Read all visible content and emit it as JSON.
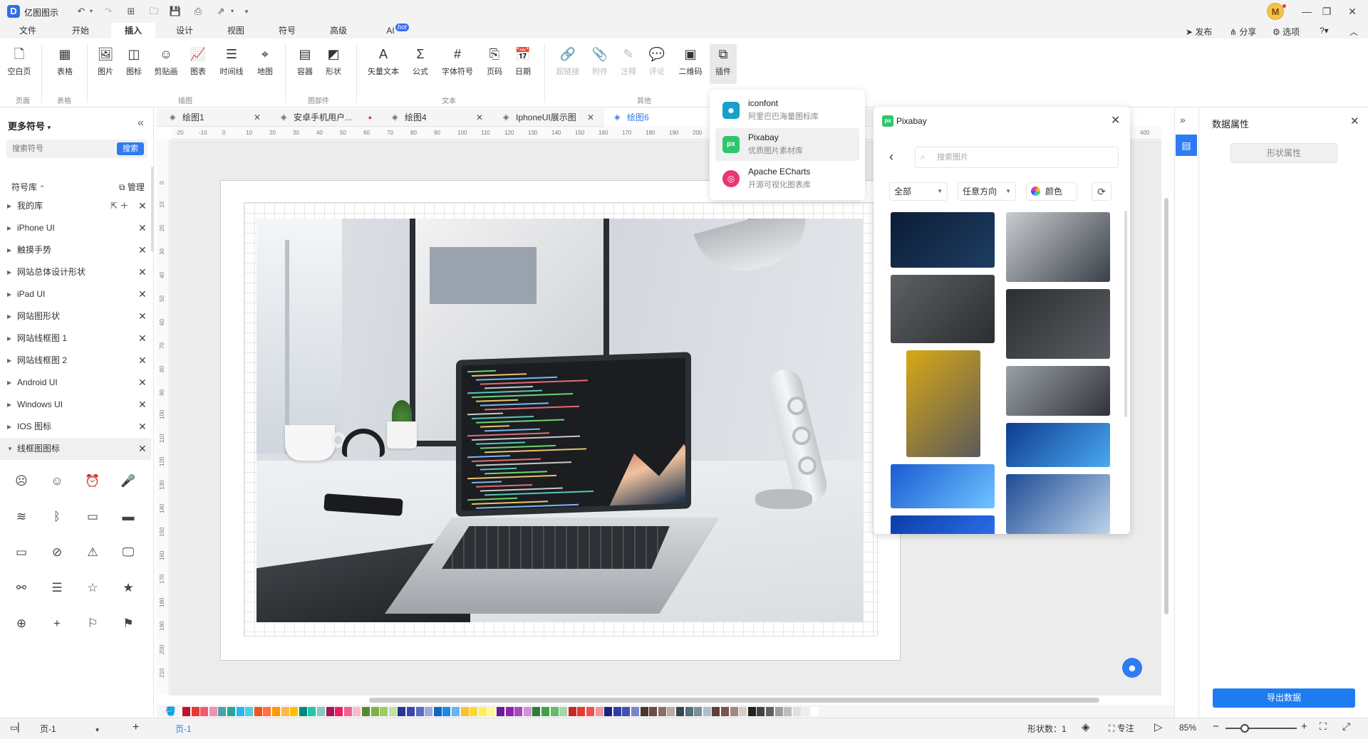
{
  "app": {
    "name": "亿图图示",
    "avatar_letter": "M"
  },
  "menu": {
    "tabs": [
      "文件",
      "开始",
      "插入",
      "设计",
      "视图",
      "符号",
      "高级",
      "AI"
    ],
    "active_index": 2,
    "hot_badge": "hot",
    "right_actions": {
      "publish": "发布",
      "share": "分享",
      "options": "选项"
    }
  },
  "ribbon": {
    "buttons": [
      {
        "label": "空白页",
        "icon": "blank-page-icon",
        "glyph": "🗋"
      },
      {
        "label": "表格",
        "icon": "table-icon",
        "glyph": "▦"
      },
      {
        "label": "图片",
        "icon": "picture-icon",
        "glyph": "🖼"
      },
      {
        "label": "图标",
        "icon": "icon-icon",
        "glyph": "◫"
      },
      {
        "label": "剪贴画",
        "icon": "clipart-icon",
        "glyph": "☺"
      },
      {
        "label": "图表",
        "icon": "chart-icon",
        "glyph": "📈"
      },
      {
        "label": "时间线",
        "icon": "timeline-icon",
        "glyph": "☰"
      },
      {
        "label": "地图",
        "icon": "map-icon",
        "glyph": "⌖"
      },
      {
        "label": "容器",
        "icon": "container-icon",
        "glyph": "▤"
      },
      {
        "label": "形状",
        "icon": "shape-icon",
        "glyph": "◩"
      },
      {
        "label": "矢量文本",
        "icon": "vector-text-icon",
        "glyph": "A"
      },
      {
        "label": "公式",
        "icon": "formula-icon",
        "glyph": "Σ"
      },
      {
        "label": "字体符号",
        "icon": "font-symbol-icon",
        "glyph": "#"
      },
      {
        "label": "页码",
        "icon": "page-number-icon",
        "glyph": "⎘"
      },
      {
        "label": "日期",
        "icon": "date-icon",
        "glyph": "📅"
      },
      {
        "label": "超链接",
        "icon": "hyperlink-icon",
        "glyph": "🔗",
        "disabled": true
      },
      {
        "label": "附件",
        "icon": "attachment-icon",
        "glyph": "📎",
        "disabled": true
      },
      {
        "label": "注释",
        "icon": "annotation-icon",
        "glyph": "✎",
        "disabled": true
      },
      {
        "label": "评论",
        "icon": "comment-icon",
        "glyph": "💬",
        "disabled": true
      },
      {
        "label": "二维码",
        "icon": "qrcode-icon",
        "glyph": "▣"
      },
      {
        "label": "插件",
        "icon": "plugin-icon",
        "glyph": "⧉",
        "pressed": true
      }
    ],
    "groups": [
      "页面",
      "表格",
      "插图",
      "图部件",
      "文本",
      "其他"
    ]
  },
  "left_panel": {
    "title": "更多符号",
    "search_placeholder": "搜索符号",
    "search_button": "搜索",
    "library_header": "符号库",
    "manage": "管理",
    "libraries": [
      "我的库",
      "iPhone UI",
      "触摸手势",
      "网站总体设计形状",
      "iPad UI",
      "网站图形状",
      "网站线框图 1",
      "网站线框图 2",
      "Android UI",
      "Windows UI",
      "IOS 图标",
      "线框图图标"
    ],
    "active_library": "线框图图标",
    "symbols": [
      {
        "name": "frown-icon",
        "glyph": "☹"
      },
      {
        "name": "smile-icon",
        "glyph": "☺"
      },
      {
        "name": "alarm-clock-icon",
        "glyph": "⏰"
      },
      {
        "name": "microphone-icon",
        "glyph": "🎤"
      },
      {
        "name": "wifi-icon",
        "glyph": "≋"
      },
      {
        "name": "bluetooth-icon",
        "glyph": "ᛒ"
      },
      {
        "name": "battery-charging-icon",
        "glyph": "▭"
      },
      {
        "name": "battery-full-icon",
        "glyph": "▬"
      },
      {
        "name": "battery-empty-icon",
        "glyph": "▭"
      },
      {
        "name": "battery-off-icon",
        "glyph": "⊘"
      },
      {
        "name": "warning-icon",
        "glyph": "⚠"
      },
      {
        "name": "monitor-icon",
        "glyph": "🖵"
      },
      {
        "name": "network-icon",
        "glyph": "⚯"
      },
      {
        "name": "list-icon",
        "glyph": "☰"
      },
      {
        "name": "star-outline-icon",
        "glyph": "☆"
      },
      {
        "name": "star-filled-icon",
        "glyph": "★"
      },
      {
        "name": "add-circle-icon",
        "glyph": "⊕"
      },
      {
        "name": "plus-icon",
        "glyph": "+"
      },
      {
        "name": "flag-outline-icon",
        "glyph": "⚐"
      },
      {
        "name": "flag-filled-icon",
        "glyph": "⚑"
      }
    ]
  },
  "doc_tabs": [
    {
      "label": "绘图1"
    },
    {
      "label": "安卓手机用户...",
      "modified": true
    },
    {
      "label": "绘图4"
    },
    {
      "label": "IphoneUI展示图"
    },
    {
      "label": "绘图6",
      "active": true
    }
  ],
  "ruler": {
    "h_ticks": [
      "-20",
      "-10",
      "0",
      "10",
      "20",
      "30",
      "40",
      "50",
      "60",
      "70",
      "80",
      "90",
      "100",
      "110",
      "120",
      "130",
      "140",
      "150",
      "160",
      "170",
      "180",
      "190",
      "200",
      "210",
      "400"
    ],
    "v_ticks": [
      "0",
      "10",
      "20",
      "30",
      "40",
      "50",
      "60",
      "70",
      "80",
      "90",
      "100",
      "110",
      "120",
      "130",
      "140",
      "150",
      "160",
      "170",
      "180",
      "190",
      "200",
      "210"
    ]
  },
  "plugin_menu": [
    {
      "name": "iconfont",
      "desc": "阿里巴巴海量图标库",
      "icon": "iconfont-icon",
      "color": "#18a0c8"
    },
    {
      "name": "Pixabay",
      "desc": "优质图片素材库",
      "icon": "pixabay-icon",
      "color": "#2ec66d",
      "hover": true
    },
    {
      "name": "Apache ECharts",
      "desc": "开源可视化图表库",
      "icon": "echarts-icon",
      "color": "#e8366e"
    }
  ],
  "pixabay": {
    "title": "Pixabay",
    "search_placeholder": "搜索图片",
    "filter_category": "全部",
    "filter_orientation": "任意方向",
    "filter_color": "颜色",
    "thumbnails": [
      {
        "name": "dark-cubes",
        "colors": [
          "#0b1d35",
          "#1e3d64"
        ]
      },
      {
        "name": "laptop-desk",
        "colors": [
          "#c9ccd0",
          "#394048"
        ]
      },
      {
        "name": "laptop-phone-gray",
        "colors": [
          "#5d6065",
          "#2b2d30"
        ]
      },
      {
        "name": "laptop-phone-dark",
        "colors": [
          "#2c2e31",
          "#5a5d62"
        ]
      },
      {
        "name": "subway-station-yellow",
        "colors": [
          "#d9a816",
          "#5a5a5a"
        ]
      },
      {
        "name": "hand-tech",
        "colors": [
          "#9aa0a6",
          "#2f3338"
        ]
      },
      {
        "name": "hexagon-tech",
        "colors": [
          "#0e3c8e",
          "#4aa8f2"
        ]
      },
      {
        "name": "blue-network",
        "colors": [
          "#1a5bd2",
          "#6fc4ff"
        ]
      },
      {
        "name": "building-blue",
        "colors": [
          "#1e4b95",
          "#bcd3ea"
        ]
      },
      {
        "name": "blue-abstract",
        "colors": [
          "#0b3ea8",
          "#2b6ee8"
        ]
      }
    ]
  },
  "right_panel": {
    "title": "数据属性",
    "shape_button": "形状属性",
    "export_button": "导出数据"
  },
  "palette": [
    "#c0142a",
    "#e53935",
    "#ef5a6b",
    "#f48fb1",
    "#4aa3a8",
    "#26a69a",
    "#29b6f6",
    "#4dd0e1",
    "#f4511e",
    "#ff7043",
    "#ff9800",
    "#ffb74d",
    "#ffc107",
    "#00897b",
    "#26c6a4",
    "#80cbc4",
    "#ad1457",
    "#e91e63",
    "#f06292",
    "#f8bbd0",
    "#558b2f",
    "#7cb342",
    "#9ccc65",
    "#c5e1a5",
    "#283593",
    "#3949ab",
    "#5c6bc0",
    "#9fa8da",
    "#1565c0",
    "#1e88e5",
    "#64b5f6",
    "#fbc02d",
    "#fdd835",
    "#ffee58",
    "#fff59d",
    "#6a1b9a",
    "#8e24aa",
    "#ab47bc",
    "#ce93d8",
    "#2e7d32",
    "#43a047",
    "#66bb6a",
    "#a5d6a7",
    "#c62828",
    "#e53935",
    "#ef5350",
    "#ef9a9a",
    "#1a237e",
    "#303f9f",
    "#3f51b5",
    "#7986cb",
    "#4e342e",
    "#6d4c41",
    "#8d6e63",
    "#bcaaa4",
    "#37474f",
    "#546e7a",
    "#78909c",
    "#b0bec5",
    "#5d4037",
    "#795548",
    "#a1887f",
    "#d7ccc8",
    "#212121",
    "#424242",
    "#616161",
    "#9e9e9e",
    "#bdbdbd",
    "#e0e0e0",
    "#eeeeee",
    "#ffffff"
  ],
  "status": {
    "page_selector": "页-1",
    "page_tab": "页-1",
    "shape_count_label": "形状数：",
    "shape_count": "1",
    "focus": "专注",
    "zoom": "85%"
  }
}
